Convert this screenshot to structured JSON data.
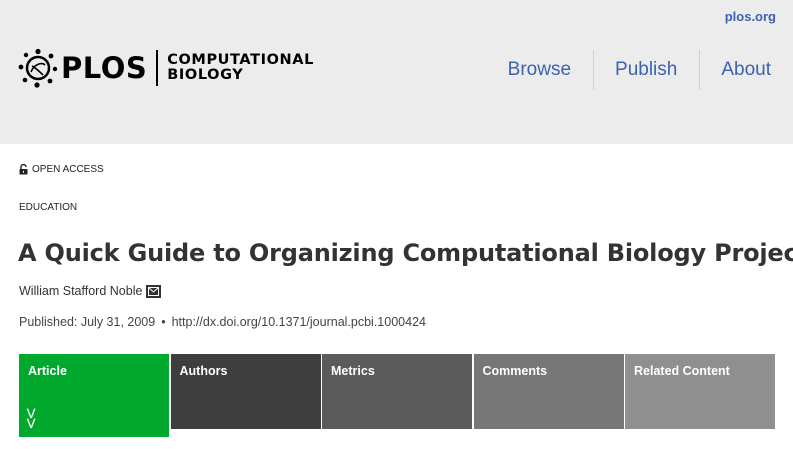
{
  "header": {
    "top_link": "plos.org",
    "logo_word": "PLOS",
    "journal_line1": "COMPUTATIONAL",
    "journal_line2": "BIOLOGY",
    "nav": [
      "Browse",
      "Publish",
      "About"
    ]
  },
  "article": {
    "access_label": "OPEN ACCESS",
    "section": "EDUCATION",
    "title": "A Quick Guide to Organizing Computational Biology Projects",
    "author": "William Stafford Noble",
    "published": "Published: July 31, 2009",
    "doi": "http://dx.doi.org/10.1371/journal.pcbi.1000424"
  },
  "tabs": [
    "Article",
    "Authors",
    "Metrics",
    "Comments",
    "Related Content"
  ],
  "colors": {
    "link_blue": "#3c63af",
    "article_tab": "#00a82d",
    "header_bg": "#ececec"
  }
}
